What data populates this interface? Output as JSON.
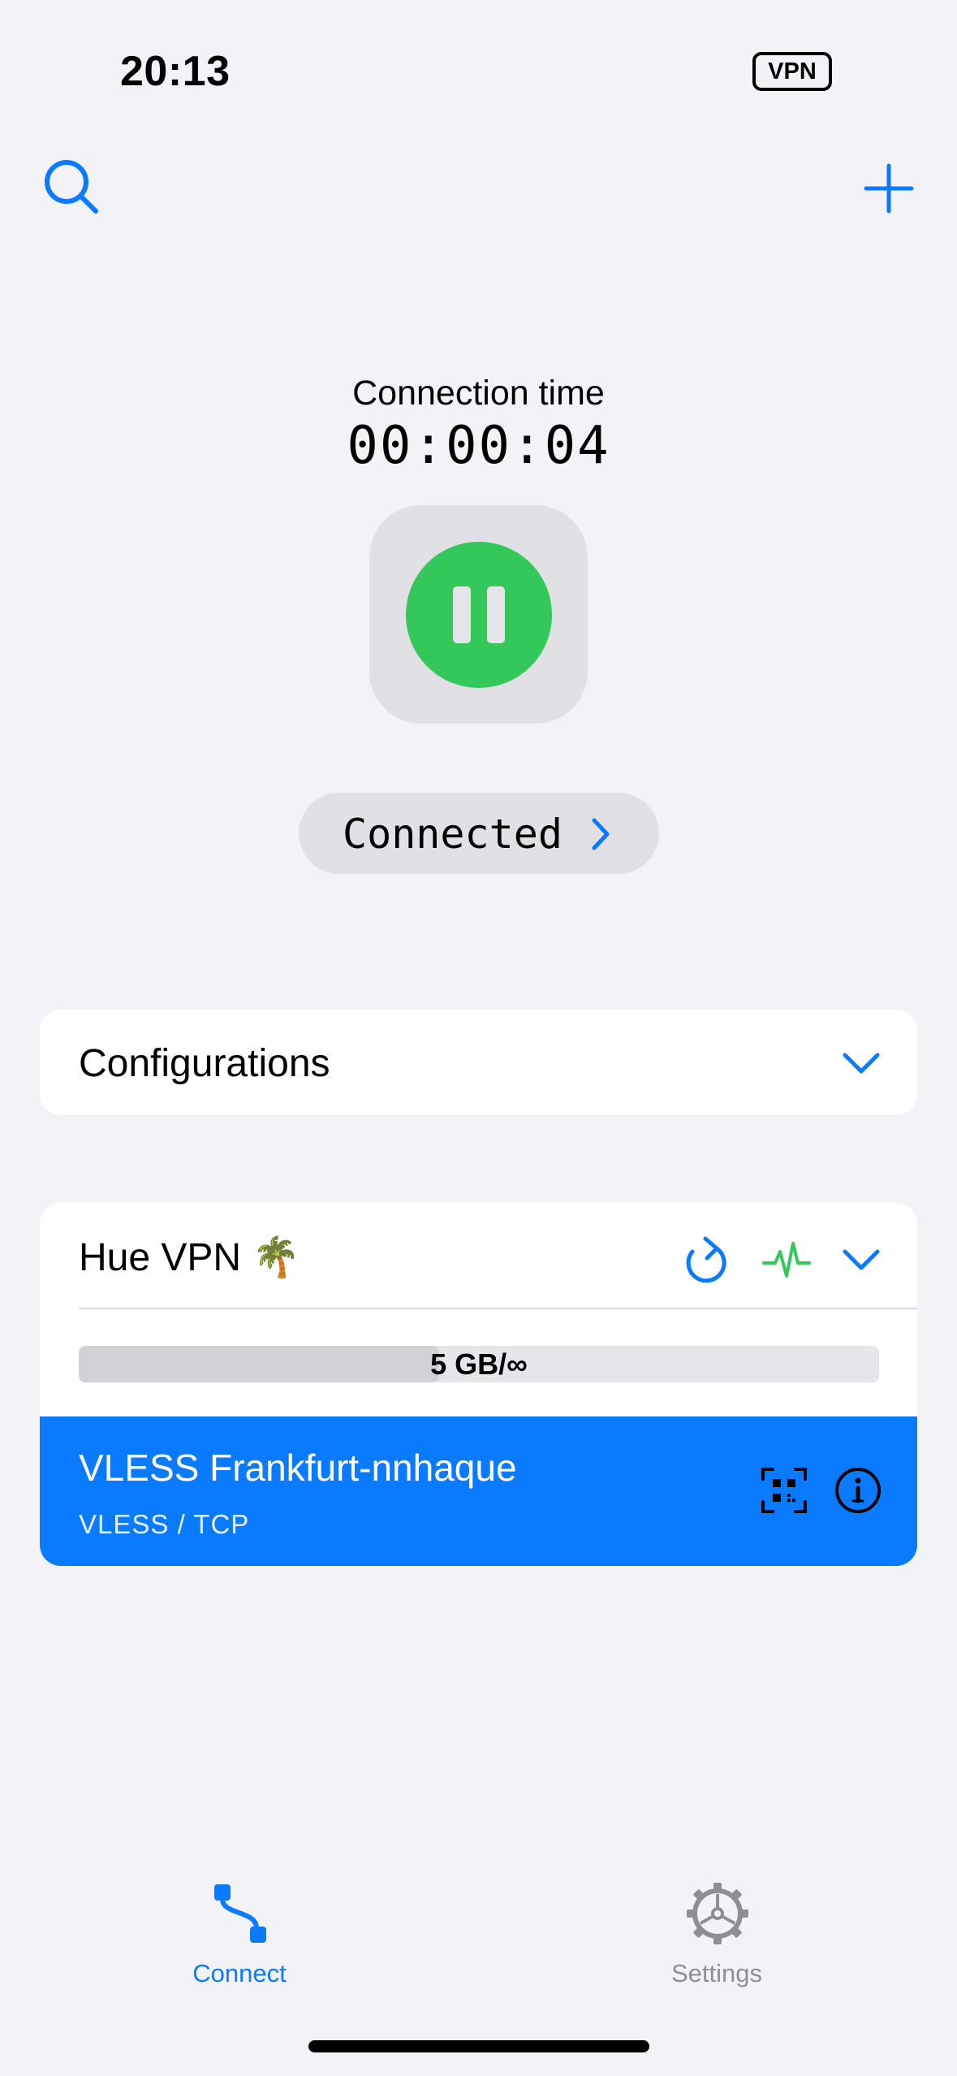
{
  "status_bar": {
    "time": "20:13",
    "vpn_badge": "VPN"
  },
  "toolbar": {
    "search_icon": "magnifying-glass",
    "add_icon": "plus"
  },
  "connection": {
    "label": "Connection time",
    "timer": "00:00:04",
    "power_button_state": "pause",
    "status": "Connected"
  },
  "configurations": {
    "label": "Configurations"
  },
  "group": {
    "title": "Hue VPN 🌴",
    "quota_text": "5 GB/∞",
    "quota_used_fraction": 0.45,
    "server": {
      "name": "VLESS Frankfurt-nnhaque",
      "protocol": "VLESS / TCP"
    }
  },
  "tabs": [
    {
      "label": "Connect",
      "icon": "path-nodes",
      "active": true
    },
    {
      "label": "Settings",
      "icon": "gear",
      "active": false
    }
  ],
  "colors": {
    "accent": "#0a7aff",
    "connected_green": "#34c759",
    "background": "#f2f2f7",
    "inactive_tab": "#8e8e93"
  }
}
